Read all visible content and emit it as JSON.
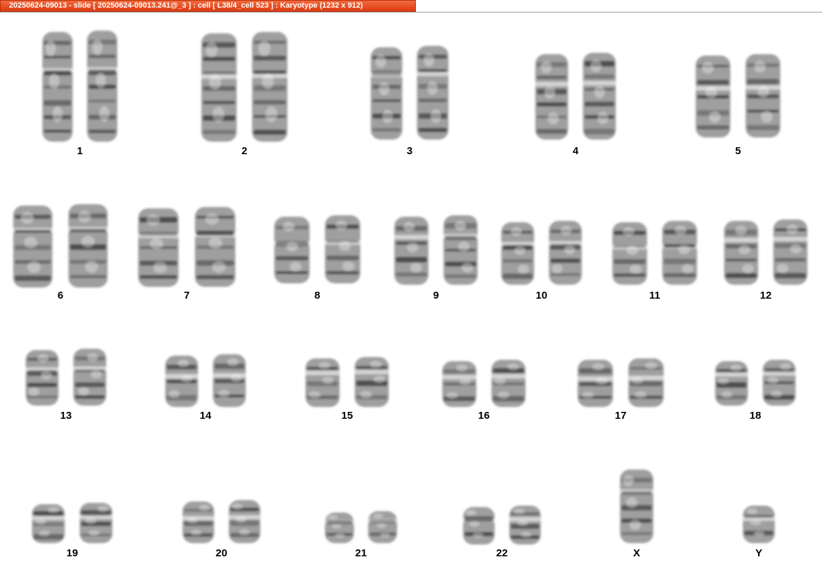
{
  "window": {
    "title": "20250624-09013 - slide [ 20250624-09013.241@_3 ] : cell [ L38/4_cell 523 ] : Karyotype  (1232 x 912)"
  },
  "colors": {
    "title_bar": "#e84a1c",
    "title_text": "#ffffff",
    "background": "#ffffff",
    "chromosome": "#2b2b2b"
  },
  "karyotype": {
    "chromosomes": [
      {
        "label": "1",
        "count": 2
      },
      {
        "label": "2",
        "count": 2
      },
      {
        "label": "3",
        "count": 2
      },
      {
        "label": "4",
        "count": 2
      },
      {
        "label": "5",
        "count": 2
      },
      {
        "label": "6",
        "count": 2
      },
      {
        "label": "7",
        "count": 2
      },
      {
        "label": "8",
        "count": 2
      },
      {
        "label": "9",
        "count": 2
      },
      {
        "label": "10",
        "count": 2
      },
      {
        "label": "11",
        "count": 2
      },
      {
        "label": "12",
        "count": 2
      },
      {
        "label": "13",
        "count": 2
      },
      {
        "label": "14",
        "count": 2
      },
      {
        "label": "15",
        "count": 2
      },
      {
        "label": "16",
        "count": 2
      },
      {
        "label": "17",
        "count": 2
      },
      {
        "label": "18",
        "count": 2
      },
      {
        "label": "19",
        "count": 2
      },
      {
        "label": "20",
        "count": 2
      },
      {
        "label": "21",
        "count": 2
      },
      {
        "label": "22",
        "count": 2
      },
      {
        "label": "X",
        "count": 1
      },
      {
        "label": "Y",
        "count": 1
      }
    ]
  }
}
